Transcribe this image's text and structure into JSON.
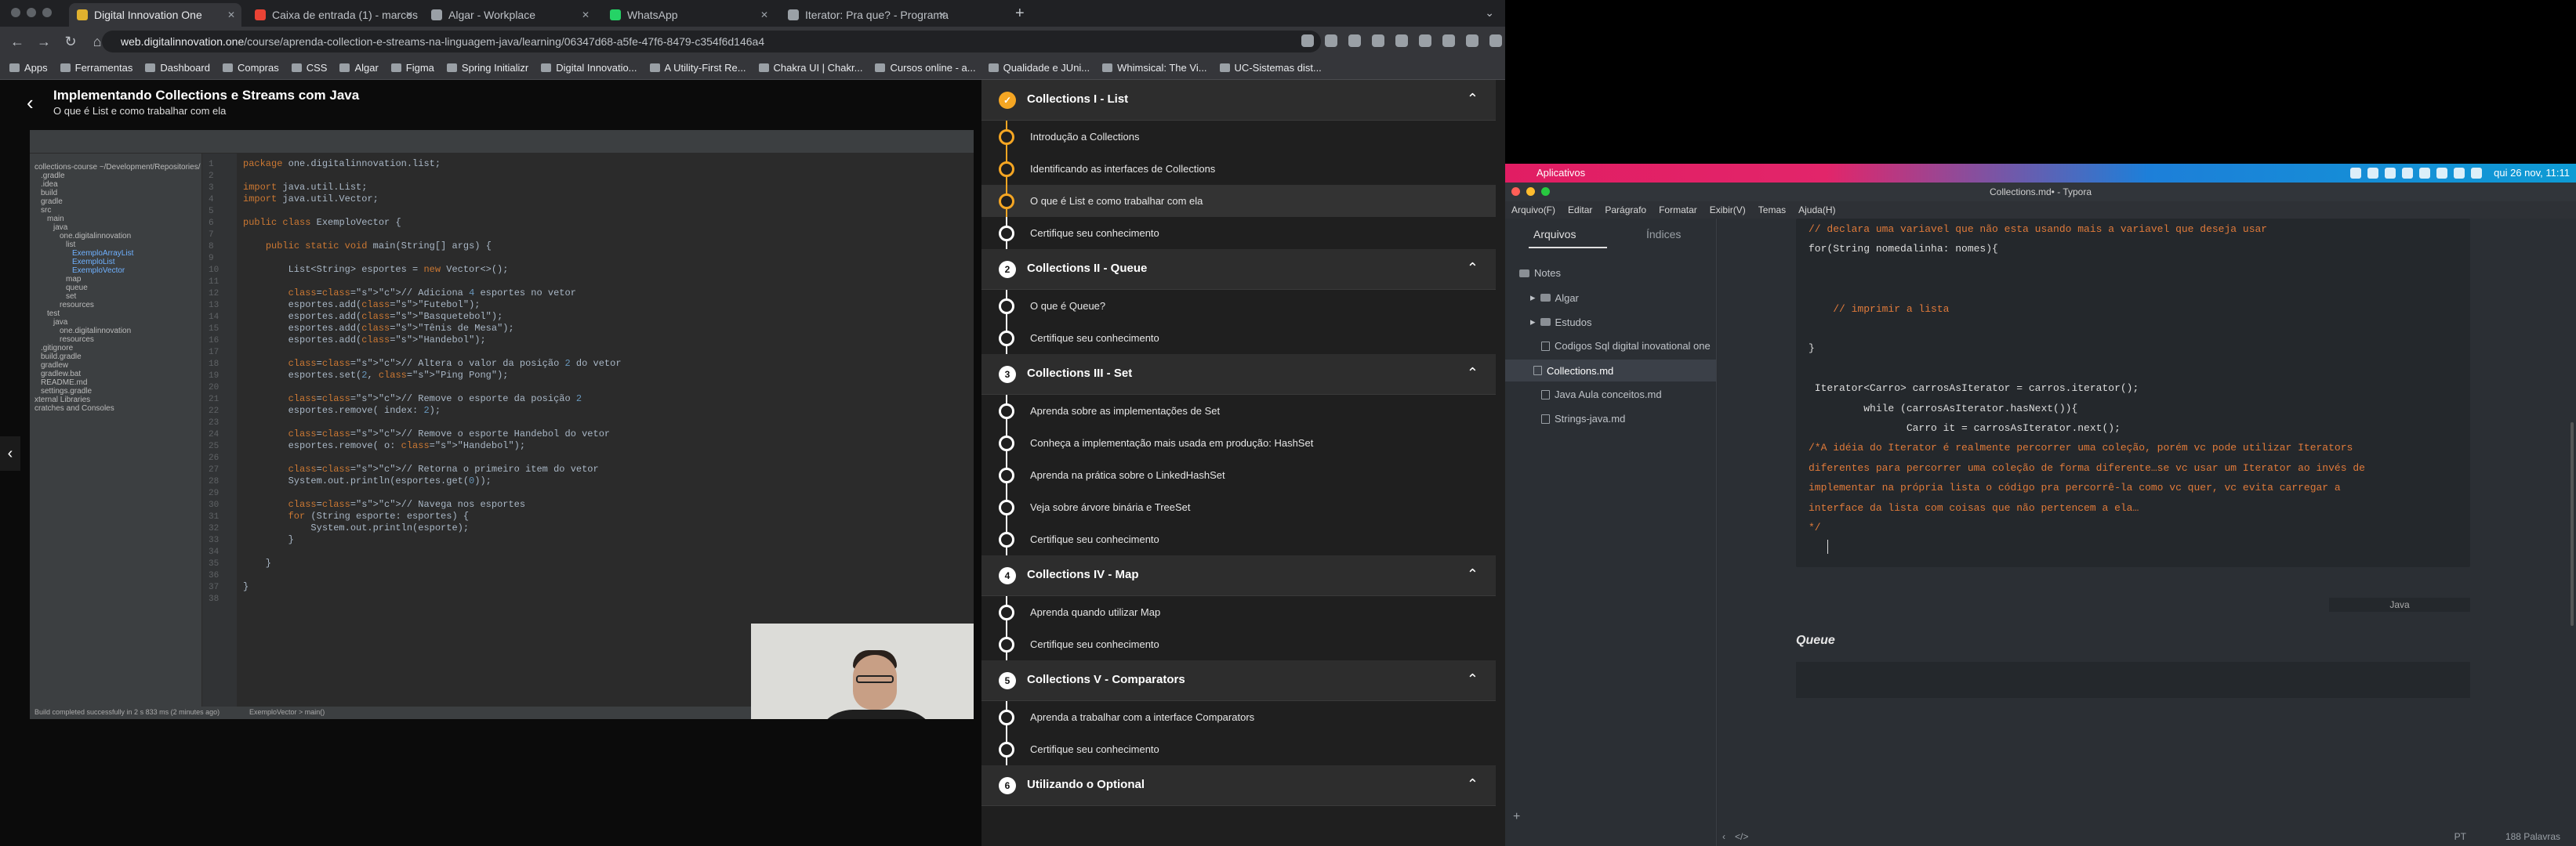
{
  "browser": {
    "tabs": [
      {
        "label": "Digital Innovation One",
        "active": true,
        "favicon_color": "#e0b12e"
      },
      {
        "label": "Caixa de entrada (1) - marcos",
        "active": false,
        "favicon_color": "#ea4335"
      },
      {
        "label": "Algar - Workplace",
        "active": false,
        "favicon_color": "#9aa0a6"
      },
      {
        "label": "WhatsApp",
        "active": false,
        "favicon_color": "#25d366"
      },
      {
        "label": "Iterator: Pra que? - Programa",
        "active": false,
        "favicon_color": "#9aa0a6"
      }
    ],
    "new_tab": "+",
    "url_host": "web.digitalinnovation.one",
    "url_path": "/course/aprenda-collection-e-streams-na-linguagem-java/learning/06347d68-a5fe-47f6-8479-c354f6d146a4",
    "bookmarks": [
      "Apps",
      "Ferramentas",
      "Dashboard",
      "Compras",
      "CSS",
      "Algar",
      "Figma",
      "Spring Initializr",
      "Digital Innovatio...",
      "A Utility-First Re...",
      "Chakra UI | Chakr...",
      "Cursos online - a...",
      "Qualidade e JUni...",
      "Whimsical: The Vi...",
      "UC-Sistemas dist..."
    ]
  },
  "course": {
    "title": "Implementando Collections e Streams com Java",
    "subtitle": "O que é List e como trabalhar com ela"
  },
  "ide": {
    "code": [
      {
        "ln": "1",
        "t": "package one.digitalinnovation.list;"
      },
      {
        "ln": "2",
        "t": ""
      },
      {
        "ln": "3",
        "t": "import java.util.List;"
      },
      {
        "ln": "4",
        "t": "import java.util.Vector;"
      },
      {
        "ln": "5",
        "t": ""
      },
      {
        "ln": "6",
        "t": "public class ExemploVector {"
      },
      {
        "ln": "7",
        "t": ""
      },
      {
        "ln": "8",
        "t": "    public static void main(String[] args) {"
      },
      {
        "ln": "9",
        "t": ""
      },
      {
        "ln": "10",
        "t": "        List<String> esportes = new Vector<>();"
      },
      {
        "ln": "11",
        "t": ""
      },
      {
        "ln": "12",
        "t": "        // Adiciona 4 esportes no vetor"
      },
      {
        "ln": "13",
        "t": "        esportes.add(\"Futebol\");"
      },
      {
        "ln": "14",
        "t": "        esportes.add(\"Basquetebol\");"
      },
      {
        "ln": "15",
        "t": "        esportes.add(\"Tênis de Mesa\");"
      },
      {
        "ln": "16",
        "t": "        esportes.add(\"Handebol\");"
      },
      {
        "ln": "17",
        "t": ""
      },
      {
        "ln": "18",
        "t": "        // Altera o valor da posição 2 do vetor"
      },
      {
        "ln": "19",
        "t": "        esportes.set(2, \"Ping Pong\");"
      },
      {
        "ln": "20",
        "t": ""
      },
      {
        "ln": "21",
        "t": "        // Remove o esporte da posição 2"
      },
      {
        "ln": "22",
        "t": "        esportes.remove( index: 2);"
      },
      {
        "ln": "23",
        "t": ""
      },
      {
        "ln": "24",
        "t": "        // Remove o esporte Handebol do vetor"
      },
      {
        "ln": "25",
        "t": "        esportes.remove( o: \"Handebol\");"
      },
      {
        "ln": "26",
        "t": ""
      },
      {
        "ln": "27",
        "t": "        // Retorna o primeiro item do vetor"
      },
      {
        "ln": "28",
        "t": "        System.out.println(esportes.get(0));"
      },
      {
        "ln": "29",
        "t": ""
      },
      {
        "ln": "30",
        "t": "        // Navega nos esportes"
      },
      {
        "ln": "31",
        "t": "        for (String esporte: esportes) {"
      },
      {
        "ln": "32",
        "t": "            System.out.println(esporte);"
      },
      {
        "ln": "33",
        "t": "        }"
      },
      {
        "ln": "34",
        "t": ""
      },
      {
        "ln": "35",
        "t": "    }"
      },
      {
        "ln": "36",
        "t": ""
      },
      {
        "ln": "37",
        "t": "}"
      },
      {
        "ln": "38",
        "t": ""
      }
    ],
    "tree": [
      "collections-course ~/Development/Repositories/",
      ".gradle",
      ".idea",
      "build",
      "gradle",
      "src",
      "main",
      "java",
      "one.digitalinnovation",
      "list",
      "ExemploArrayList",
      "ExemploList",
      "ExemploVector",
      "map",
      "queue",
      "set",
      "resources",
      "test",
      "java",
      "one.digitalinnovation",
      "resources",
      ".gitignore",
      "build.gradle",
      "gradlew",
      "gradlew.bat",
      "README.md",
      "settings.gradle",
      "xternal Libraries",
      "cratches and Consoles"
    ],
    "status": "Build completed successfully in 2 s 833 ms (2 minutes ago)",
    "breadcrumb": "ExemploVector  >  main()"
  },
  "sidebar": {
    "sections": [
      {
        "num": "✓",
        "title": "Collections I - List",
        "done": true,
        "lessons": [
          {
            "label": "Introdução a Collections",
            "done": true
          },
          {
            "label": "Identificando as interfaces de Collections",
            "done": true
          },
          {
            "label": "O que é List e como trabalhar com ela",
            "done": true,
            "current": true
          },
          {
            "label": "Certifique seu conhecimento",
            "cert": true
          }
        ]
      },
      {
        "num": "2",
        "title": "Collections II - Queue",
        "lessons": [
          {
            "label": "O que é Queue?"
          },
          {
            "label": "Certifique seu conhecimento",
            "cert": true
          }
        ]
      },
      {
        "num": "3",
        "title": "Collections III - Set",
        "lessons": [
          {
            "label": "Aprenda sobre as implementações de Set"
          },
          {
            "label": "Conheça a implementação mais usada em produção: HashSet"
          },
          {
            "label": "Aprenda na prática sobre o LinkedHashSet"
          },
          {
            "label": "Veja sobre árvore binária e TreeSet"
          },
          {
            "label": "Certifique seu conhecimento",
            "cert": true
          }
        ]
      },
      {
        "num": "4",
        "title": "Collections IV - Map",
        "lessons": [
          {
            "label": "Aprenda quando utilizar Map"
          },
          {
            "label": "Certifique seu conhecimento",
            "cert": true
          }
        ]
      },
      {
        "num": "5",
        "title": "Collections V - Comparators",
        "lessons": [
          {
            "label": "Aprenda a trabalhar com a interface Comparators"
          },
          {
            "label": "Certifique seu conhecimento",
            "cert": true
          }
        ]
      },
      {
        "num": "6",
        "title": "Utilizando o Optional",
        "lessons": []
      }
    ]
  },
  "desktop": {
    "apps_label": "Aplicativos",
    "clock": "qui 26 nov, 11:11"
  },
  "typora": {
    "window_title": "Collections.md• - Typora",
    "menu": [
      "Arquivo(F)",
      "Editar",
      "Parágrafo",
      "Formatar",
      "Exibir(V)",
      "Temas",
      "Ajuda(H)"
    ],
    "tab_files": "Arquivos",
    "tab_index": "Índices",
    "files": [
      {
        "label": "Notes",
        "kind": "folder",
        "indent": 0
      },
      {
        "label": "Algar",
        "kind": "folder",
        "indent": 1
      },
      {
        "label": "Estudos",
        "kind": "folder",
        "indent": 1
      },
      {
        "label": "Codigos Sql digital inovational one",
        "kind": "file",
        "indent": 2
      },
      {
        "label": "Collections.md",
        "kind": "file",
        "indent": 2,
        "selected": true
      },
      {
        "label": "Java Aula conceitos.md",
        "kind": "file",
        "indent": 2
      },
      {
        "label": "Strings-java.md",
        "kind": "file",
        "indent": 2
      }
    ],
    "code_lines": [
      {
        "t": "// declara uma variavel que não esta usando mais a variavel que deseja usar",
        "cls": "cm",
        "indent": 0
      },
      {
        "t": "for(String nomedalinha: nomes){",
        "cls": "tx",
        "indent": 0
      },
      {
        "t": "",
        "cls": "tx",
        "indent": 0
      },
      {
        "t": "",
        "cls": "tx",
        "indent": 0
      },
      {
        "t": "    // imprimir a lista",
        "cls": "cm",
        "indent": 0
      },
      {
        "t": "",
        "cls": "tx",
        "indent": 0
      },
      {
        "t": "}",
        "cls": "tx",
        "indent": 0
      },
      {
        "t": "",
        "cls": "tx",
        "indent": 0
      },
      {
        "t": " Iterator<Carro> carrosAsIterator = carros.iterator();",
        "cls": "tx",
        "indent": 0
      },
      {
        "t": "         while (carrosAsIterator.hasNext()){",
        "cls": "tx",
        "indent": 0
      },
      {
        "t": "                Carro it = carrosAsIterator.next();",
        "cls": "tx",
        "indent": 0
      },
      {
        "t": "/*A idéia do Iterator é realmente percorrer uma coleção, porém vc pode utilizar Iterators",
        "cls": "cm",
        "indent": 0
      },
      {
        "t": "diferentes para percorrer uma coleção de forma diferente…se vc usar um Iterator ao invés de",
        "cls": "cm",
        "indent": 0
      },
      {
        "t": "implementar na própria lista o código pra percorrê-la como vc quer, vc evita carregar a",
        "cls": "cm",
        "indent": 0
      },
      {
        "t": "interface da lista com coisas que não pertencem a ela…",
        "cls": "cm",
        "indent": 0
      },
      {
        "t": "*/",
        "cls": "cm",
        "indent": 0
      }
    ],
    "code_lang": "Java",
    "heading": "Queue",
    "status_lang": "PT",
    "word_count": "188 Palavras"
  },
  "colors": {
    "accent": "#f5a623",
    "sidebar_bg": "#1f1f1f",
    "section_bg": "#2d2d2d"
  }
}
